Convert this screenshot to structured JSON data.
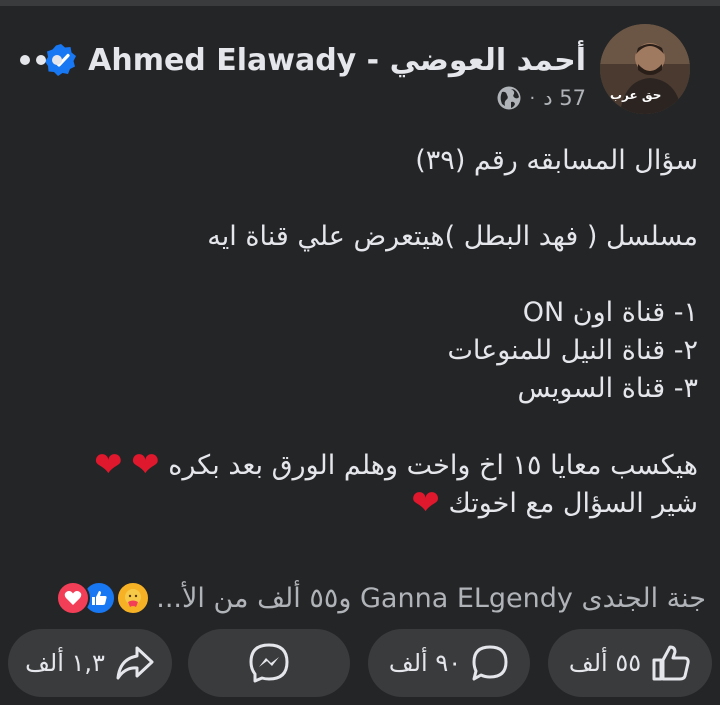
{
  "post": {
    "author_name": "Ahmed Elawady - أحمد العوضي",
    "time": "57 د",
    "separator": "·",
    "avatar_caption": "حق عرب",
    "text_lines": [
      "سؤال المسابقه رقم (٣٩)",
      "",
      "مسلسل ( فهد  البطل )هيتعرض علي قناة ايه",
      "",
      "١- قناة اون ON",
      "٢- قناة النيل للمنوعات",
      "٣- قناة السويس",
      "",
      "هيكسب معايا ١٥ اخ واخت وهلم الورق بعد بكره",
      "شير السؤال مع اخوتك"
    ]
  },
  "reactions": {
    "summary": "جنة الجندى Ganna ELgendy و٥٥ ألف من الأ...",
    "icons": [
      "heart-reaction",
      "like-reaction",
      "care-reaction"
    ]
  },
  "actions": {
    "like_count": "٥٥ ألف",
    "comment_count": "٩٠ ألف",
    "share_count": "١,٣ ألف"
  },
  "colors": {
    "background": "#242526",
    "button_bg": "#3a3b3c",
    "verified_blue": "#1877f2",
    "heart_red": "#e0182d",
    "secondary_text": "#b0b3b8"
  }
}
